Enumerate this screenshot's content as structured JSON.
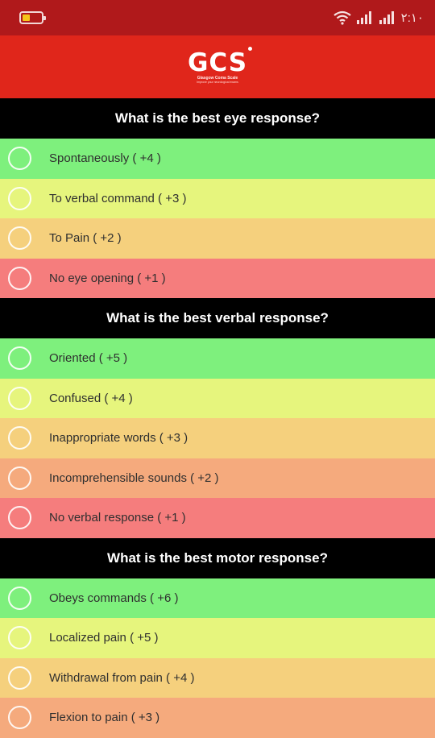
{
  "status_bar": {
    "battery_icon": "battery-low-icon",
    "wifi_icon": "wifi-icon",
    "signal_icon": "signal-icon",
    "time": "۲:۱۰",
    "colors": {
      "background": "#b0191b"
    }
  },
  "header": {
    "logo_text": "GCS",
    "logo_subtitle": "Glasgow Coma Scale",
    "logo_tagline": "Improve your neurological exams",
    "colors": {
      "background": "#e0261b"
    }
  },
  "colors": {
    "green": "#7ef07d",
    "yellow": "#e6f57d",
    "light_orange": "#f5d07d",
    "orange": "#f5aa7d",
    "red": "#f57d7d",
    "section_bg": "#000000"
  },
  "sections": [
    {
      "title": "What is the best eye response?",
      "options": [
        {
          "label": "Spontaneously ( +4 )",
          "color": "green"
        },
        {
          "label": "To verbal command ( +3 )",
          "color": "yellow"
        },
        {
          "label": "To Pain ( +2 )",
          "color": "light_orange"
        },
        {
          "label": "No eye opening ( +1 )",
          "color": "red"
        }
      ]
    },
    {
      "title": "What is the best verbal response?",
      "options": [
        {
          "label": "Oriented ( +5 )",
          "color": "green"
        },
        {
          "label": "Confused ( +4 )",
          "color": "yellow"
        },
        {
          "label": "Inappropriate words ( +3 )",
          "color": "light_orange"
        },
        {
          "label": "Incomprehensible sounds ( +2 )",
          "color": "orange"
        },
        {
          "label": "No verbal response ( +1 )",
          "color": "red"
        }
      ]
    },
    {
      "title": "What is the best motor response?",
      "options": [
        {
          "label": "Obeys commands ( +6 )",
          "color": "green"
        },
        {
          "label": "Localized pain ( +5 )",
          "color": "yellow"
        },
        {
          "label": "Withdrawal from pain ( +4 )",
          "color": "light_orange"
        },
        {
          "label": "Flexion to pain ( +3 )",
          "color": "orange"
        }
      ]
    }
  ]
}
